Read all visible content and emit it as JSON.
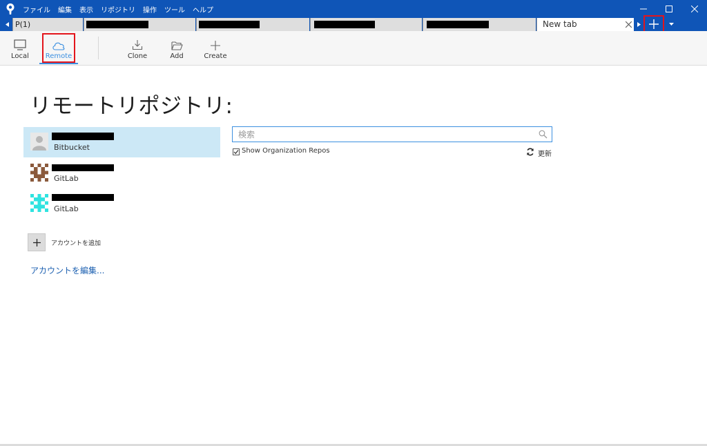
{
  "menu": [
    "ファイル",
    "編集",
    "表示",
    "リポジトリ",
    "操作",
    "ツール",
    "ヘルプ"
  ],
  "tabs": [
    {
      "label": "P(1)"
    },
    {
      "label": ""
    },
    {
      "label": ""
    },
    {
      "label": ""
    },
    {
      "label": ""
    },
    {
      "label": "New tab"
    }
  ],
  "toolbar": {
    "local": "Local",
    "remote": "Remote",
    "clone": "Clone",
    "add": "Add",
    "create": "Create"
  },
  "page": {
    "heading": "リモートリポジトリ:"
  },
  "accounts": [
    {
      "provider": "Bitbucket",
      "selected": true
    },
    {
      "provider": "GitLab",
      "selected": false
    },
    {
      "provider": "GitLab",
      "selected": false
    }
  ],
  "add_account_label": "アカウントを追加",
  "edit_accounts_link": "アカウントを編集...",
  "search": {
    "placeholder": "検索",
    "value": ""
  },
  "show_org_repos": {
    "label": "Show Organization Repos",
    "checked": true
  },
  "refresh_label": "更新",
  "colors": {
    "titlebar": "#0f55b7",
    "accent": "#3b8fe0",
    "selected_row": "#cce8f6",
    "highlight_box": "#e3141b",
    "link": "#1b5fb0"
  }
}
